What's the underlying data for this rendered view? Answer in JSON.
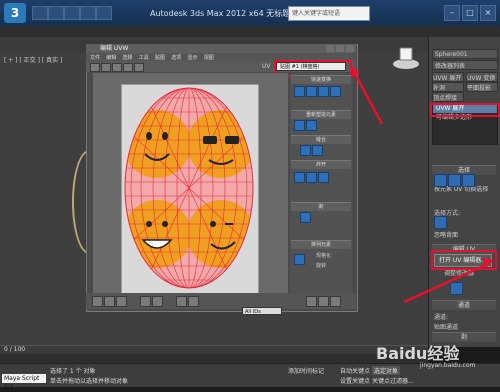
{
  "app": {
    "title": "Autodesk 3ds Max 2012 x64    无标题",
    "search_placeholder": "键入关键字或短语",
    "logo_glyph": "3"
  },
  "viewport": {
    "label": "[ + ] [ 正交 ] [ 真实 ]"
  },
  "uvw_editor": {
    "title": "编辑 UVW",
    "menus": [
      "文件",
      "编辑",
      "选择",
      "工具",
      "贴图",
      "选项",
      "显示",
      "视图"
    ],
    "uv_label": "UV",
    "map_dropdown": "贴图 #1 (棋盘格)",
    "side_sections": [
      "快速变换",
      "重新塑造元素",
      "缝合",
      "炸开",
      "剥",
      "排列元素"
    ],
    "side_checks": [
      "规格化",
      "旋转"
    ],
    "bottom_field": "All IDs"
  },
  "command_panel": {
    "object_name": "Sphere001",
    "modifier_list_label": "修改器列表",
    "modifier_buttons": [
      "UVW 展开",
      "UVW 变换",
      "补洞",
      "平面投影",
      "顶点焊接"
    ],
    "stack_items": [
      "UVW 展开",
      "可编辑多边形"
    ],
    "sections": [
      "选择",
      "编辑 UV",
      "通道",
      "剥"
    ],
    "selection_labels": [
      "按元素 UV 切换选择",
      "选择方式:",
      "忽略背面"
    ],
    "open_uv_editor_button": "打开 UV 编辑器...",
    "view_label": "调整修改器",
    "channel_labels": [
      "通道:",
      "贴图通道"
    ]
  },
  "timeline": {
    "frame_text": "0 / 100"
  },
  "status": {
    "listener": "Maya Script 0:1",
    "selected": "选择了 1 个 对象",
    "prompt": "单击并拖动以选择并移动对象",
    "add_time_tag": "添加时间标记",
    "autokey_label": "自动关键点",
    "set_key_label": "设置关键点",
    "selection_set": "选定对象",
    "key_filters": "关键点过滤器..."
  },
  "watermark": {
    "brand": "Baidu经验",
    "url": "jingyan.baidu.com"
  },
  "colors": {
    "highlight": "#e8102a",
    "mesh": "#e8283a",
    "face": "#f0a020",
    "accent_blue": "#2d6fb8"
  }
}
